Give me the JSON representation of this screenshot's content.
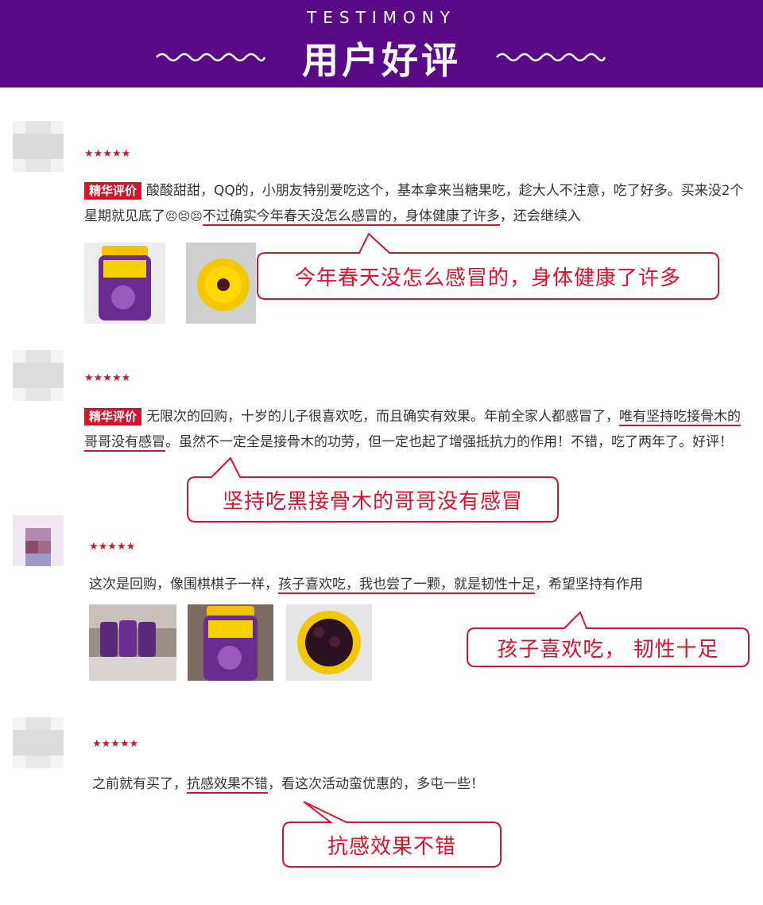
{
  "header": {
    "subtitle": "TESTIMONY",
    "title": "用户好评",
    "bg": "#5b0a87"
  },
  "accent": "#d2142d",
  "reviews": [
    {
      "stars": "★★★★★",
      "tag": "精华评价",
      "text_before": "酸酸甜甜，QQ的，小朋友特别爱吃这个，基本拿来当糖果吃，趁大人不注意，吃了好多。买来没2个星期就见底了",
      "emoji": "😣😣😣",
      "text_highlight": "不过确实今年春天没怎么感冒的，身体健康了许多",
      "text_after": "，还会继续入",
      "bubble": "今年春天没怎么感冒的，身体健康了许多"
    },
    {
      "stars": "★★★★★",
      "tag": "精华评价",
      "text_before": "无限次的回购，十岁的儿子很喜欢吃，而且确实有效果。年前全家人都感冒了，",
      "text_highlight": "唯有坚持吃接骨木的哥哥没有感冒",
      "text_after": "。虽然不一定全是接骨木的功劳，但一定也起了增强抵抗力的作用！不错，吃了两年了。好评！",
      "bubble": "坚持吃黑接骨木的哥哥没有感冒"
    },
    {
      "stars": "★★★★★",
      "text_before": "这次是回购，像围棋棋子一样，",
      "text_highlight": "孩子喜欢吃，我也尝了一颗，就是韧性十足",
      "text_after": "，希望坚持有作用",
      "bubble": "孩子喜欢吃，  韧性十足"
    },
    {
      "stars": "★★★★★",
      "text_before": "之前就有买了，",
      "text_highlight": "抗感效果不错",
      "text_after": "，看这次活动蛮优惠的，多屯一些！",
      "bubble": "抗感效果不错"
    }
  ],
  "photos": {
    "r1": [
      "gummy-bottle-photo",
      "bottle-open-photo"
    ],
    "r3": [
      "bottles-shelf-photo",
      "gummy-bottle-photo",
      "gummies-in-jar-photo"
    ]
  }
}
